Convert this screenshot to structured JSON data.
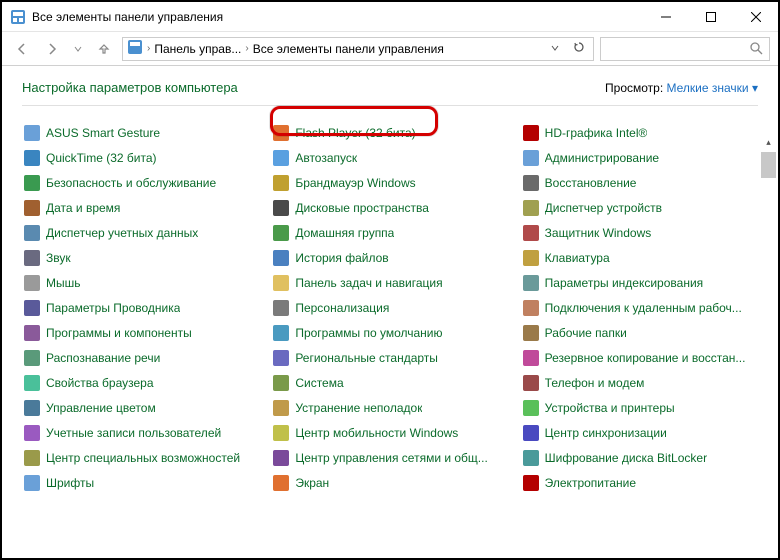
{
  "window": {
    "title": "Все элементы панели управления"
  },
  "breadcrumbs": {
    "item1": "Панель управ...",
    "item2": "Все элементы панели управления"
  },
  "page": {
    "title": "Настройка параметров компьютера",
    "viewLabel": "Просмотр:",
    "viewValue": "Мелкие значки"
  },
  "items": [
    {
      "label": "ASUS Smart Gesture"
    },
    {
      "label": "Flash Player (32 бита)"
    },
    {
      "label": "HD-графика Intel®"
    },
    {
      "label": "QuickTime (32 бита)"
    },
    {
      "label": "Автозапуск"
    },
    {
      "label": "Администрирование"
    },
    {
      "label": "Безопасность и обслуживание"
    },
    {
      "label": "Брандмауэр Windows"
    },
    {
      "label": "Восстановление"
    },
    {
      "label": "Дата и время"
    },
    {
      "label": "Дисковые пространства"
    },
    {
      "label": "Диспетчер устройств"
    },
    {
      "label": "Диспетчер учетных данных"
    },
    {
      "label": "Домашняя группа"
    },
    {
      "label": "Защитник Windows"
    },
    {
      "label": "Звук"
    },
    {
      "label": "История файлов"
    },
    {
      "label": "Клавиатура"
    },
    {
      "label": "Мышь"
    },
    {
      "label": "Панель задач и навигация"
    },
    {
      "label": "Параметры индексирования"
    },
    {
      "label": "Параметры Проводника"
    },
    {
      "label": "Персонализация"
    },
    {
      "label": "Подключения к удаленным рабоч..."
    },
    {
      "label": "Программы и компоненты"
    },
    {
      "label": "Программы по умолчанию"
    },
    {
      "label": "Рабочие папки"
    },
    {
      "label": "Распознавание речи"
    },
    {
      "label": "Региональные стандарты"
    },
    {
      "label": "Резервное копирование и восстан..."
    },
    {
      "label": "Свойства браузера"
    },
    {
      "label": "Система"
    },
    {
      "label": "Телефон и модем"
    },
    {
      "label": "Управление цветом"
    },
    {
      "label": "Устранение неполадок"
    },
    {
      "label": "Устройства и принтеры"
    },
    {
      "label": "Учетные записи пользователей"
    },
    {
      "label": "Центр мобильности Windows"
    },
    {
      "label": "Центр синхронизации"
    },
    {
      "label": "Центр специальных возможностей"
    },
    {
      "label": "Центр управления сетями и общ..."
    },
    {
      "label": "Шифрование диска BitLocker"
    },
    {
      "label": "Шрифты"
    },
    {
      "label": "Экран"
    },
    {
      "label": "Электропитание"
    }
  ]
}
